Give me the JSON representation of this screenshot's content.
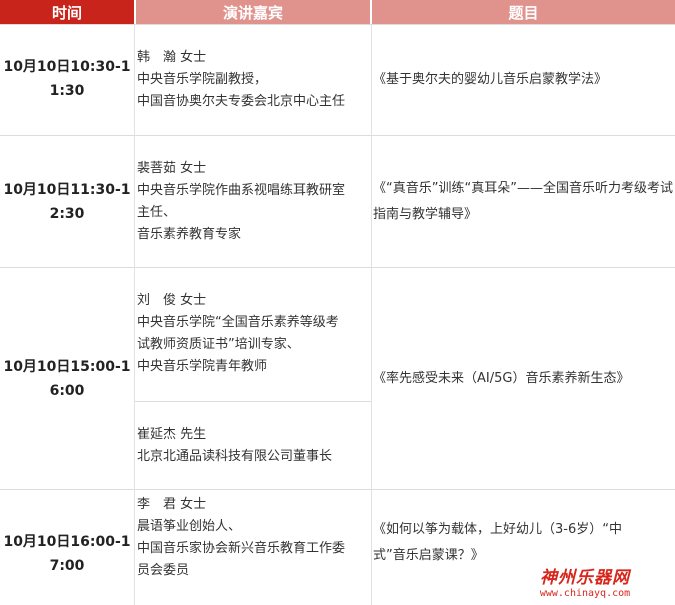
{
  "header": {
    "time": "时间",
    "speaker": "演讲嘉宾",
    "topic": "题目"
  },
  "rows": [
    {
      "time": [
        "10月10日10:30-1",
        "1:30"
      ],
      "speakers": [
        {
          "name": "韩　瀚  女士",
          "lines": [
            "中央音乐学院副教授，",
            "中国音协奥尔夫专委会北京中心主任"
          ]
        }
      ],
      "topic": "《基于奥尔夫的婴幼儿音乐启蒙教学法》"
    },
    {
      "time": [
        "10月10日11:30-1",
        "2:30"
      ],
      "speakers": [
        {
          "name": "裴菩茹  女士",
          "lines": [
            "中央音乐学院作曲系视唱练耳教研室",
            "主任、",
            "音乐素养教育专家"
          ]
        }
      ],
      "topic": "《“真音乐”训练“真耳朵”——全国音乐听力考级考试指南与教学辅导》"
    },
    {
      "time": [
        "10月10日15:00-1",
        "6:00"
      ],
      "speakers": [
        {
          "name": "刘　俊  女士",
          "lines": [
            "中央音乐学院“全国音乐素养等级考",
            "试教师资质证书”培训专家、",
            "中央音乐学院青年教师"
          ]
        },
        {
          "name": "崔延杰  先生",
          "lines": [
            "北京北通品读科技有限公司董事长"
          ]
        }
      ],
      "topic": "《率先感受未来（AI/5G）音乐素养新生态》"
    },
    {
      "time": [
        "10月10日16:00-1",
        "7:00"
      ],
      "speakers": [
        {
          "name": "李　君  女士",
          "lines": [
            "晨语筝业创始人、",
            "中国音乐家协会新兴音乐教育工作委",
            "员会委员"
          ]
        }
      ],
      "topic": "《如何以筝为载体，上好幼儿（3-6岁）“中国音乐启蒙课？》",
      "topic_lines": [
        "《如何以筝为载体，上好幼儿（3-6岁）“中",
        "式”音乐启蒙课？》"
      ]
    }
  ],
  "watermark": {
    "cn": "神州乐器网",
    "en": "www.chinayq.com"
  },
  "colors": {
    "header_time": "#c8241b",
    "header_other": "#e0928d",
    "grid": "#dcdcdc",
    "logo": "#d8261c"
  }
}
